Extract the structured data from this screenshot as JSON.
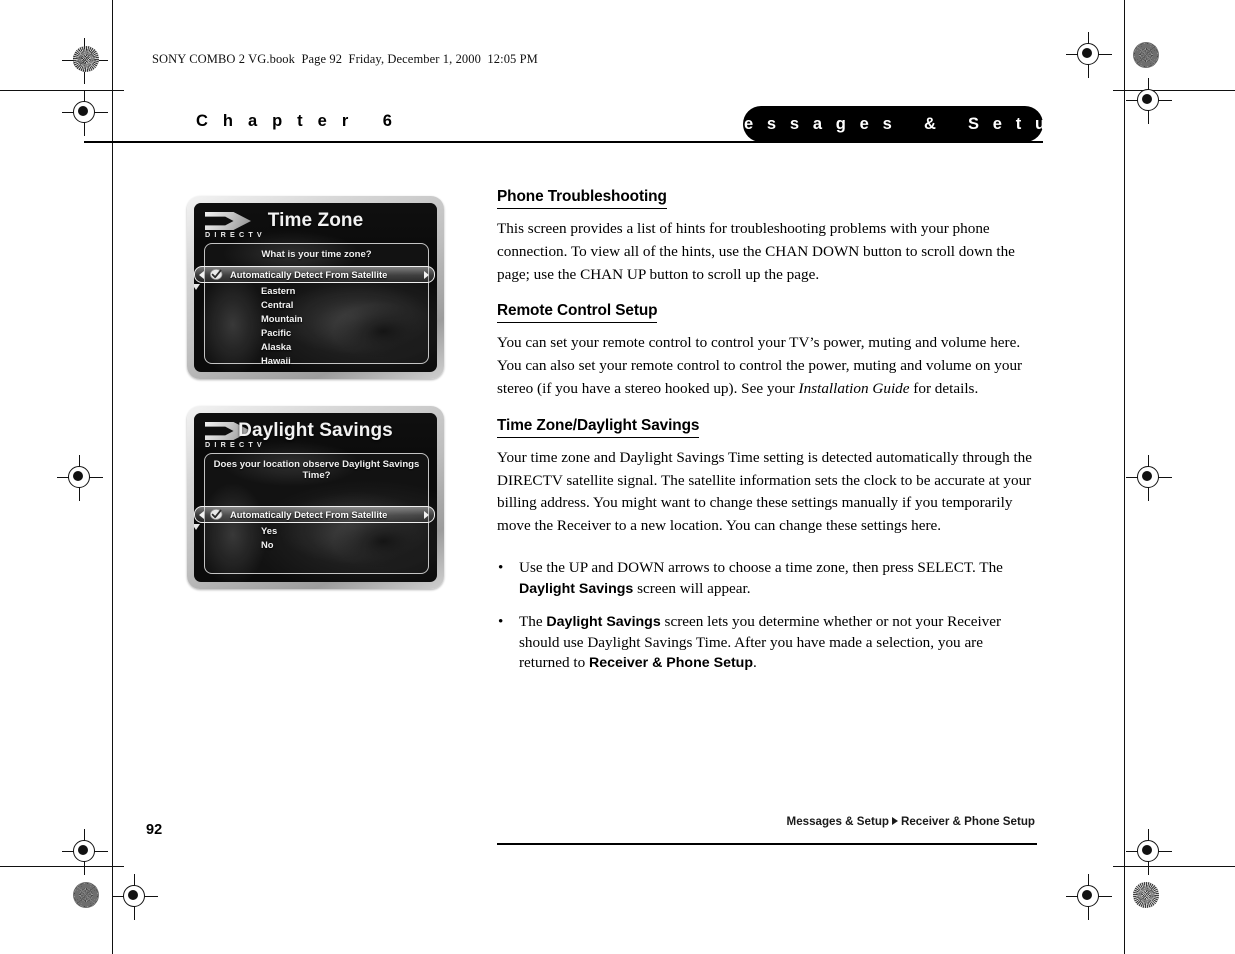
{
  "file_info": "SONY COMBO 2 VG.book  Page 92  Friday, December 1, 2000  12:05 PM",
  "header": {
    "chapter": "C h a p t e r   6",
    "section_pill": "M e s s a g e s   &   S e t u p"
  },
  "figures": [
    {
      "logo_word": "D I R E C T V",
      "title": "Time Zone",
      "question": "What is your time zone?",
      "highlight": "Automatically Detect From Satellite",
      "options": [
        "Eastern",
        "Central",
        "Mountain",
        "Pacific",
        "Alaska",
        "Hawaii"
      ]
    },
    {
      "logo_word": "D I R E C T V",
      "title": "Daylight Savings",
      "question": "Does your location observe Daylight Savings Time?",
      "highlight": "Automatically Detect From Satellite",
      "options": [
        "Yes",
        "No"
      ]
    }
  ],
  "sections": [
    {
      "heading": "Phone Troubleshooting",
      "paragraph": "This screen provides a list of hints for troubleshooting problems with your phone connection. To view all of the hints, use the CHAN DOWN button to scroll down the page; use the CHAN UP button to scroll up the page."
    },
    {
      "heading": "Remote Control Setup",
      "para_part1": "You can set your remote control to control your TV’s power, muting and volume here. You can also set your remote control to control the power, muting and volume on your stereo (if you have a stereo hooked up). See your ",
      "para_italic": "Installation Guide",
      "para_part2": " for details."
    },
    {
      "heading": "Time Zone/Daylight Savings",
      "paragraph": "Your time zone and Daylight Savings Time setting is detected automatically through the DIRECTV satellite signal. The satellite information sets the clock to be accurate at your billing address. You might want to change these settings manually if you temporarily move the Receiver to a new location. You can change these settings here."
    }
  ],
  "bullets": [
    {
      "marker": "•",
      "part1": "Use the UP and DOWN arrows to choose a time zone, then press SELECT. The ",
      "bold1": "Daylight Savings",
      "part2": " screen will appear."
    },
    {
      "marker": "•",
      "part1": "The ",
      "bold1": "Daylight Savings",
      "part2": " screen lets you determine whether or not your Receiver should use Daylight Savings Time. After you have made a selection, you are returned to ",
      "bold2": "Receiver & Phone Setup",
      "part3": "."
    }
  ],
  "footer": {
    "page_number": "92",
    "crumb_left": "Messages & Setup",
    "crumb_right": "Receiver & Phone Setup"
  }
}
